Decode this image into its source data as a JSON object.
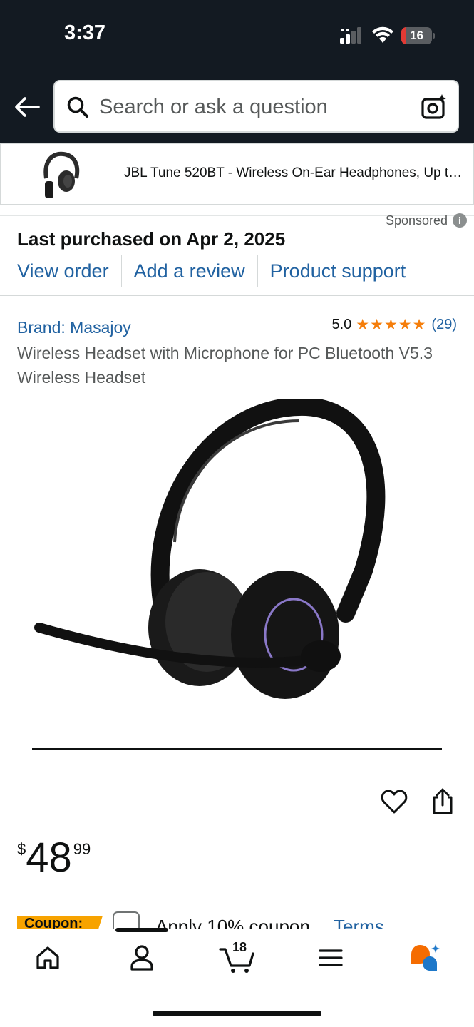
{
  "status_bar": {
    "time": "3:37",
    "battery_level": "16",
    "battery_fraction": 0.16,
    "icons": [
      "cellular-signal-icon",
      "wifi-icon",
      "battery-icon"
    ]
  },
  "header": {
    "back_icon": "arrow-left-icon",
    "search_placeholder": "Search or ask a question",
    "search_icon": "search-icon",
    "camera_icon": "camera-sparkle-icon"
  },
  "sponsored_ad": {
    "title": "JBL Tune 520BT - Wireless On-Ear Headphones, Up to…",
    "label": "Sponsored",
    "info_icon": "info-icon"
  },
  "purchase": {
    "title": "Last purchased on Apr 2, 2025",
    "links": [
      "View order",
      "Add a review",
      "Product support"
    ]
  },
  "product": {
    "brand": "Brand: Masajoy",
    "rating_value": "5.0",
    "rating_stars": 5,
    "rating_count": "(29)",
    "title": "Wireless Headset with Microphone for PC Bluetooth V5.3 Wireless Headset",
    "price_symbol": "$",
    "price_whole": "48",
    "price_fraction": "99"
  },
  "coupon": {
    "badge": "Coupon:",
    "text": "Apply 10% coupon",
    "terms": "Terms"
  },
  "bottom_nav": {
    "cart_count": "18",
    "items": [
      "home-icon",
      "account-icon",
      "cart-icon",
      "menu-icon",
      "rufus-assistant-icon"
    ]
  },
  "colors": {
    "header_bg": "#131a22",
    "link": "#2162a1",
    "star": "#f57e0b",
    "coupon": "#f7a300"
  }
}
